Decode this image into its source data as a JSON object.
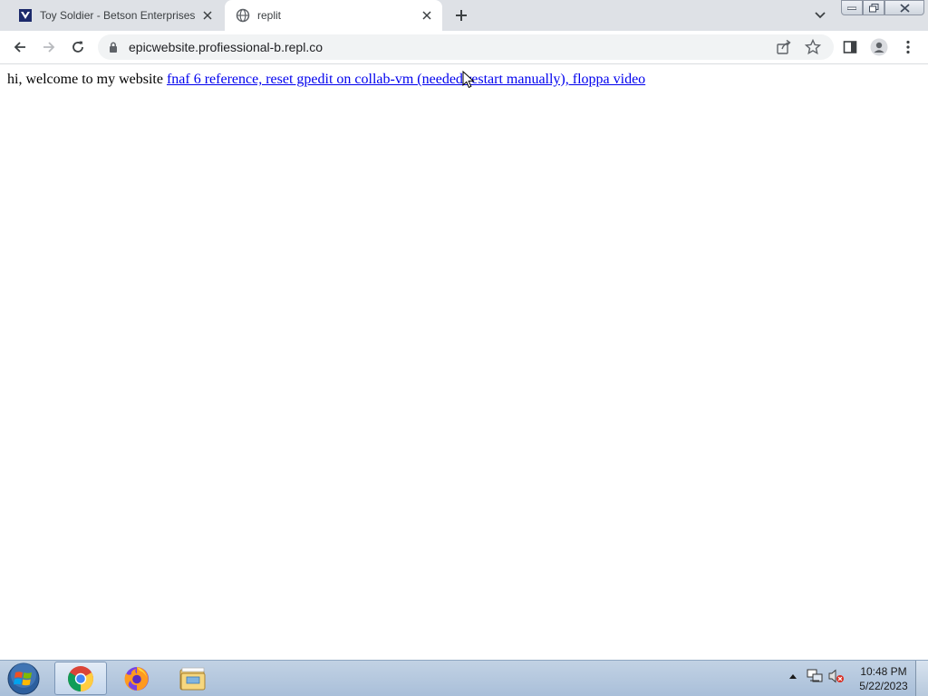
{
  "tabs": [
    {
      "title": "Toy Soldier - Betson Enterprises",
      "favicon": "betson-logo-icon",
      "active": false
    },
    {
      "title": "replit",
      "favicon": "globe-icon",
      "active": true
    }
  ],
  "toolbar": {
    "url": "epicwebsite.profiessional-b.repl.co"
  },
  "page": {
    "intro": "hi, welcome to my website ",
    "link_text": "fnaf 6 reference, reset gpedit on collab-vm (needed restart manually), floppa video"
  },
  "taskbar": {
    "apps": [
      "chrome-icon",
      "firefox-icon",
      "file-explorer-icon"
    ],
    "time": "10:48 PM",
    "date": "5/22/2023"
  },
  "colors": {
    "link": "#0000ee",
    "tabstrip": "#dee1e6",
    "taskbar": "#b0c4dc"
  }
}
